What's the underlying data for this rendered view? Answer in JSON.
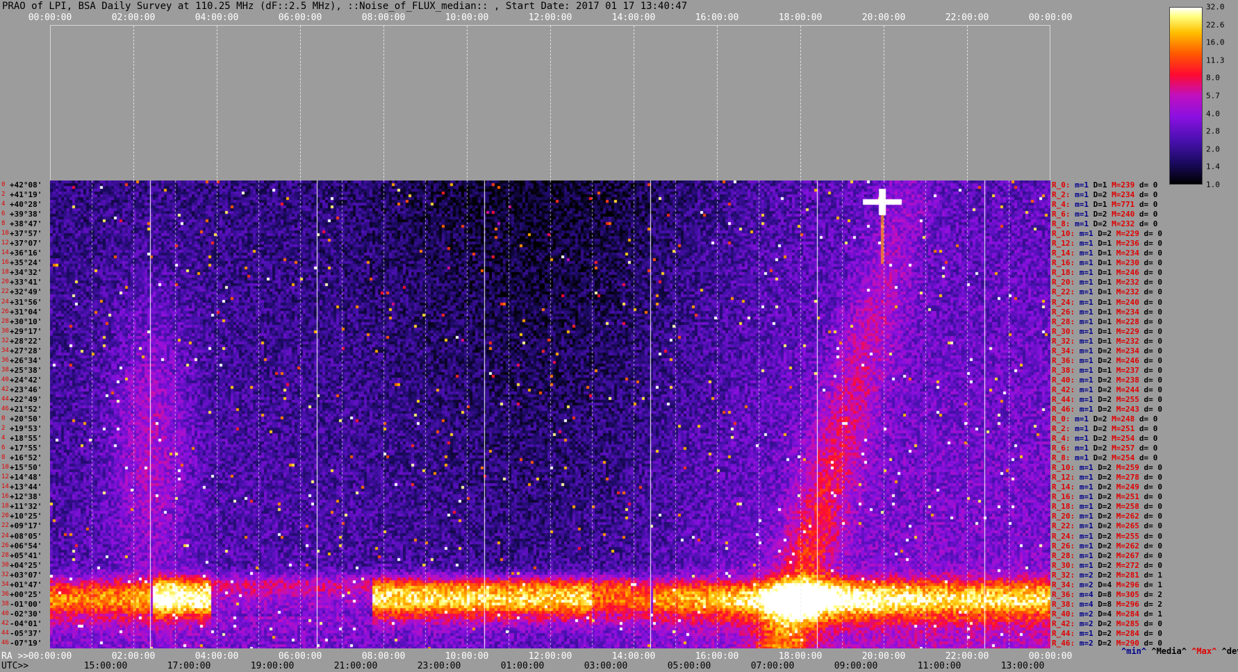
{
  "title": "PRAO of LPI, BSA Daily Survey at 110.25 MHz (dF::2.5 MHz), ::Noise_of_FLUX_median:: , Start Date: 2017 01 17 13:40:47",
  "top_axis": [
    "00:00:00",
    "02:00:00",
    "04:00:00",
    "06:00:00",
    "08:00:00",
    "10:00:00",
    "12:00:00",
    "14:00:00",
    "16:00:00",
    "18:00:00",
    "20:00:00",
    "22:00:00",
    "00:00:00"
  ],
  "bottom_axis": {
    "ra_label": "RA >>",
    "utc_label": "UTC>>",
    "ra_ticks": [
      "00:00:00",
      "02:00:00",
      "04:00:00",
      "06:00:00",
      "08:00:00",
      "10:00:00",
      "12:00:00",
      "14:00:00",
      "16:00:00",
      "18:00:00",
      "20:00:00",
      "22:00:00",
      "00:00:00"
    ],
    "utc_ticks": [
      "15:00:00",
      "17:00:00",
      "19:00:00",
      "21:00:00",
      "23:00:00",
      "01:00:00",
      "03:00:00",
      "05:00:00",
      "07:00:00",
      "09:00:00",
      "11:00:00",
      "13:00:00"
    ]
  },
  "legend_keys": {
    "min": "^min^",
    "median": "^Media^",
    "max": "^Max^",
    "devia": "^devia^"
  },
  "colors": {
    "background": "#9c9c9c",
    "stat_red": "#e00000",
    "stat_blue": "#00008b"
  },
  "chart_data": {
    "type": "heatmap",
    "title": "PRAO of LPI, BSA Daily Survey at 110.25 MHz (dF::2.5 MHz), ::Noise_of_FLUX_median:: , Start Date: 2017 01 17 13:40:47",
    "x_axis": {
      "label": "RA",
      "ticks": [
        "00:00:00",
        "02:00:00",
        "04:00:00",
        "06:00:00",
        "08:00:00",
        "10:00:00",
        "12:00:00",
        "14:00:00",
        "16:00:00",
        "18:00:00",
        "20:00:00",
        "22:00:00",
        "00:00:00"
      ],
      "range_hours": [
        0,
        24
      ]
    },
    "colorbar": {
      "ticks": [
        "1.0",
        "1.4",
        "2.0",
        "2.8",
        "4.0",
        "5.7",
        "8.0",
        "11.3",
        "16.0",
        "22.6",
        "32.0"
      ],
      "range": [
        1.0,
        32.0
      ],
      "scale": "log"
    },
    "row_indices": [
      "0",
      "2",
      "4",
      "6",
      "8",
      "10",
      "12",
      "14",
      "16",
      "18",
      "20",
      "22",
      "24",
      "26",
      "28",
      "30",
      "32",
      "34",
      "36",
      "38",
      "40",
      "42",
      "44",
      "46",
      "0",
      "2",
      "4",
      "6",
      "8",
      "10",
      "12",
      "14",
      "16",
      "18",
      "20",
      "22",
      "24",
      "26",
      "28",
      "30",
      "32",
      "34",
      "36",
      "38",
      "40",
      "42",
      "44",
      "46"
    ],
    "declinations": [
      "+42°08'",
      "+41°19'",
      "+40°28'",
      "+39°38'",
      "+38°47'",
      "+37°57'",
      "+37°07'",
      "+36°16'",
      "+35°24'",
      "+34°32'",
      "+33°41'",
      "+32°49'",
      "+31°56'",
      "+31°04'",
      "+30°10'",
      "+29°17'",
      "+28°22'",
      "+27°28'",
      "+26°34'",
      "+25°38'",
      "+24°42'",
      "+23°46'",
      "+22°49'",
      "+21°52'",
      "+20°50'",
      "+19°53'",
      "+18°55'",
      "+17°55'",
      "+16°52'",
      "+15°50'",
      "+14°48'",
      "+13°44'",
      "+12°38'",
      "+11°32'",
      "+10°25'",
      "+09°17'",
      "+08°05'",
      "+06°54'",
      "+05°41'",
      "+04°25'",
      "+03°07'",
      "+01°47'",
      "+00°25'",
      "-01°00'",
      "-02°30'",
      "-04°01'",
      "-05°37'",
      "-07°19'"
    ],
    "row_stats": [
      {
        "r": "R_0:",
        "m": "1",
        "d": "1",
        "M": "239",
        "dv": "0"
      },
      {
        "r": "R_2:",
        "m": "1",
        "d": "2",
        "M": "234",
        "dv": "0"
      },
      {
        "r": "R_4:",
        "m": "1",
        "d": "1",
        "M": "771",
        "dv": "0"
      },
      {
        "r": "R_6:",
        "m": "1",
        "d": "2",
        "M": "240",
        "dv": "0"
      },
      {
        "r": "R_8:",
        "m": "1",
        "d": "2",
        "M": "232",
        "dv": "0"
      },
      {
        "r": "R_10:",
        "m": "1",
        "d": "2",
        "M": "229",
        "dv": "0"
      },
      {
        "r": "R_12:",
        "m": "1",
        "d": "1",
        "M": "236",
        "dv": "0"
      },
      {
        "r": "R_14:",
        "m": "1",
        "d": "1",
        "M": "234",
        "dv": "0"
      },
      {
        "r": "R_16:",
        "m": "1",
        "d": "1",
        "M": "230",
        "dv": "0"
      },
      {
        "r": "R_18:",
        "m": "1",
        "d": "1",
        "M": "246",
        "dv": "0"
      },
      {
        "r": "R_20:",
        "m": "1",
        "d": "1",
        "M": "232",
        "dv": "0"
      },
      {
        "r": "R_22:",
        "m": "1",
        "d": "1",
        "M": "232",
        "dv": "0"
      },
      {
        "r": "R_24:",
        "m": "1",
        "d": "1",
        "M": "240",
        "dv": "0"
      },
      {
        "r": "R_26:",
        "m": "1",
        "d": "1",
        "M": "234",
        "dv": "0"
      },
      {
        "r": "R_28:",
        "m": "1",
        "d": "1",
        "M": "228",
        "dv": "0"
      },
      {
        "r": "R_30:",
        "m": "1",
        "d": "1",
        "M": "229",
        "dv": "0"
      },
      {
        "r": "R_32:",
        "m": "1",
        "d": "1",
        "M": "232",
        "dv": "0"
      },
      {
        "r": "R_34:",
        "m": "1",
        "d": "2",
        "M": "234",
        "dv": "0"
      },
      {
        "r": "R_36:",
        "m": "1",
        "d": "2",
        "M": "246",
        "dv": "0"
      },
      {
        "r": "R_38:",
        "m": "1",
        "d": "1",
        "M": "237",
        "dv": "0"
      },
      {
        "r": "R_40:",
        "m": "1",
        "d": "2",
        "M": "238",
        "dv": "0"
      },
      {
        "r": "R_42:",
        "m": "1",
        "d": "2",
        "M": "244",
        "dv": "0"
      },
      {
        "r": "R_44:",
        "m": "1",
        "d": "2",
        "M": "255",
        "dv": "0"
      },
      {
        "r": "R_46:",
        "m": "1",
        "d": "2",
        "M": "243",
        "dv": "0"
      },
      {
        "r": "R_0:",
        "m": "1",
        "d": "2",
        "M": "248",
        "dv": "0"
      },
      {
        "r": "R_2:",
        "m": "1",
        "d": "2",
        "M": "251",
        "dv": "0"
      },
      {
        "r": "R_4:",
        "m": "1",
        "d": "2",
        "M": "254",
        "dv": "0"
      },
      {
        "r": "R_6:",
        "m": "1",
        "d": "2",
        "M": "257",
        "dv": "0"
      },
      {
        "r": "R_8:",
        "m": "1",
        "d": "2",
        "M": "254",
        "dv": "0"
      },
      {
        "r": "R_10:",
        "m": "1",
        "d": "2",
        "M": "259",
        "dv": "0"
      },
      {
        "r": "R_12:",
        "m": "1",
        "d": "2",
        "M": "278",
        "dv": "0"
      },
      {
        "r": "R_14:",
        "m": "1",
        "d": "2",
        "M": "249",
        "dv": "0"
      },
      {
        "r": "R_16:",
        "m": "1",
        "d": "2",
        "M": "251",
        "dv": "0"
      },
      {
        "r": "R_18:",
        "m": "1",
        "d": "2",
        "M": "258",
        "dv": "0"
      },
      {
        "r": "R_20:",
        "m": "1",
        "d": "2",
        "M": "262",
        "dv": "0"
      },
      {
        "r": "R_22:",
        "m": "1",
        "d": "2",
        "M": "265",
        "dv": "0"
      },
      {
        "r": "R_24:",
        "m": "1",
        "d": "2",
        "M": "255",
        "dv": "0"
      },
      {
        "r": "R_26:",
        "m": "1",
        "d": "2",
        "M": "262",
        "dv": "0"
      },
      {
        "r": "R_28:",
        "m": "1",
        "d": "2",
        "M": "267",
        "dv": "0"
      },
      {
        "r": "R_30:",
        "m": "1",
        "d": "2",
        "M": "272",
        "dv": "0"
      },
      {
        "r": "R_32:",
        "m": "2",
        "d": "2",
        "M": "281",
        "dv": "1"
      },
      {
        "r": "R_34:",
        "m": "2",
        "d": "4",
        "M": "296",
        "dv": "1"
      },
      {
        "r": "R_36:",
        "m": "4",
        "d": "8",
        "M": "305",
        "dv": "2"
      },
      {
        "r": "R_38:",
        "m": "4",
        "d": "8",
        "M": "296",
        "dv": "2"
      },
      {
        "r": "R_40:",
        "m": "2",
        "d": "4",
        "M": "284",
        "dv": "1"
      },
      {
        "r": "R_42:",
        "m": "2",
        "d": "2",
        "M": "285",
        "dv": "0"
      },
      {
        "r": "R_44:",
        "m": "1",
        "d": "2",
        "M": "284",
        "dv": "0"
      },
      {
        "r": "R_46:",
        "m": "2",
        "d": "2",
        "M": "290",
        "dv": "0"
      }
    ]
  }
}
